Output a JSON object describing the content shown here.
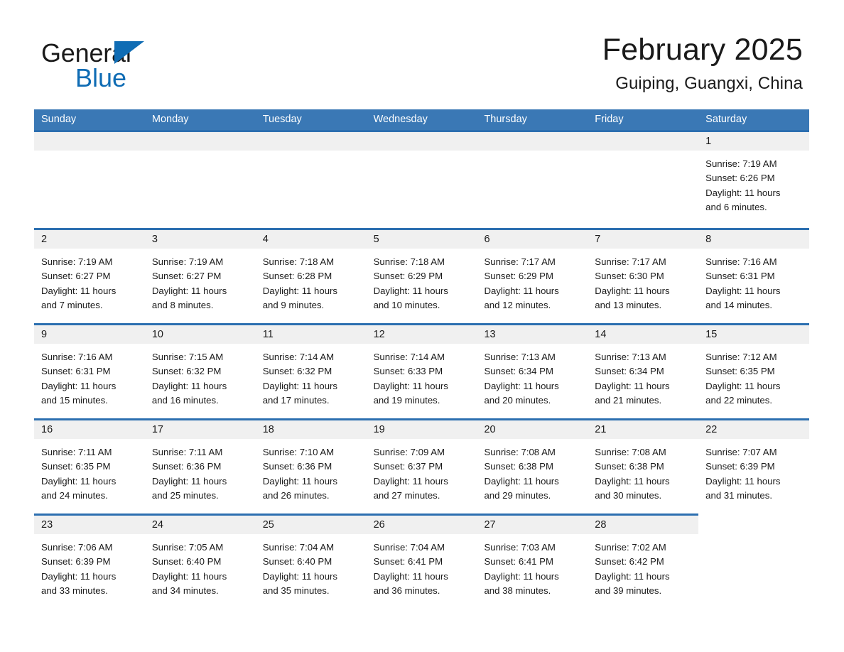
{
  "brand": {
    "name_part1": "General",
    "name_part2": "Blue",
    "accent_color": "#0f6cb4",
    "triangle_icon": "triangle-icon"
  },
  "header": {
    "month_title": "February 2025",
    "location": "Guiping, Guangxi, China"
  },
  "calendar": {
    "header_bg": "#3a78b5",
    "row_rule_color": "#2c6fb0",
    "daynum_band_bg": "#f0f0f0",
    "weekdays": [
      "Sunday",
      "Monday",
      "Tuesday",
      "Wednesday",
      "Thursday",
      "Friday",
      "Saturday"
    ],
    "weeks": [
      [
        {
          "day": "",
          "lines": []
        },
        {
          "day": "",
          "lines": []
        },
        {
          "day": "",
          "lines": []
        },
        {
          "day": "",
          "lines": []
        },
        {
          "day": "",
          "lines": []
        },
        {
          "day": "",
          "lines": []
        },
        {
          "day": "1",
          "lines": [
            "Sunrise: 7:19 AM",
            "Sunset: 6:26 PM",
            "Daylight: 11 hours",
            "and 6 minutes."
          ]
        }
      ],
      [
        {
          "day": "2",
          "lines": [
            "Sunrise: 7:19 AM",
            "Sunset: 6:27 PM",
            "Daylight: 11 hours",
            "and 7 minutes."
          ]
        },
        {
          "day": "3",
          "lines": [
            "Sunrise: 7:19 AM",
            "Sunset: 6:27 PM",
            "Daylight: 11 hours",
            "and 8 minutes."
          ]
        },
        {
          "day": "4",
          "lines": [
            "Sunrise: 7:18 AM",
            "Sunset: 6:28 PM",
            "Daylight: 11 hours",
            "and 9 minutes."
          ]
        },
        {
          "day": "5",
          "lines": [
            "Sunrise: 7:18 AM",
            "Sunset: 6:29 PM",
            "Daylight: 11 hours",
            "and 10 minutes."
          ]
        },
        {
          "day": "6",
          "lines": [
            "Sunrise: 7:17 AM",
            "Sunset: 6:29 PM",
            "Daylight: 11 hours",
            "and 12 minutes."
          ]
        },
        {
          "day": "7",
          "lines": [
            "Sunrise: 7:17 AM",
            "Sunset: 6:30 PM",
            "Daylight: 11 hours",
            "and 13 minutes."
          ]
        },
        {
          "day": "8",
          "lines": [
            "Sunrise: 7:16 AM",
            "Sunset: 6:31 PM",
            "Daylight: 11 hours",
            "and 14 minutes."
          ]
        }
      ],
      [
        {
          "day": "9",
          "lines": [
            "Sunrise: 7:16 AM",
            "Sunset: 6:31 PM",
            "Daylight: 11 hours",
            "and 15 minutes."
          ]
        },
        {
          "day": "10",
          "lines": [
            "Sunrise: 7:15 AM",
            "Sunset: 6:32 PM",
            "Daylight: 11 hours",
            "and 16 minutes."
          ]
        },
        {
          "day": "11",
          "lines": [
            "Sunrise: 7:14 AM",
            "Sunset: 6:32 PM",
            "Daylight: 11 hours",
            "and 17 minutes."
          ]
        },
        {
          "day": "12",
          "lines": [
            "Sunrise: 7:14 AM",
            "Sunset: 6:33 PM",
            "Daylight: 11 hours",
            "and 19 minutes."
          ]
        },
        {
          "day": "13",
          "lines": [
            "Sunrise: 7:13 AM",
            "Sunset: 6:34 PM",
            "Daylight: 11 hours",
            "and 20 minutes."
          ]
        },
        {
          "day": "14",
          "lines": [
            "Sunrise: 7:13 AM",
            "Sunset: 6:34 PM",
            "Daylight: 11 hours",
            "and 21 minutes."
          ]
        },
        {
          "day": "15",
          "lines": [
            "Sunrise: 7:12 AM",
            "Sunset: 6:35 PM",
            "Daylight: 11 hours",
            "and 22 minutes."
          ]
        }
      ],
      [
        {
          "day": "16",
          "lines": [
            "Sunrise: 7:11 AM",
            "Sunset: 6:35 PM",
            "Daylight: 11 hours",
            "and 24 minutes."
          ]
        },
        {
          "day": "17",
          "lines": [
            "Sunrise: 7:11 AM",
            "Sunset: 6:36 PM",
            "Daylight: 11 hours",
            "and 25 minutes."
          ]
        },
        {
          "day": "18",
          "lines": [
            "Sunrise: 7:10 AM",
            "Sunset: 6:36 PM",
            "Daylight: 11 hours",
            "and 26 minutes."
          ]
        },
        {
          "day": "19",
          "lines": [
            "Sunrise: 7:09 AM",
            "Sunset: 6:37 PM",
            "Daylight: 11 hours",
            "and 27 minutes."
          ]
        },
        {
          "day": "20",
          "lines": [
            "Sunrise: 7:08 AM",
            "Sunset: 6:38 PM",
            "Daylight: 11 hours",
            "and 29 minutes."
          ]
        },
        {
          "day": "21",
          "lines": [
            "Sunrise: 7:08 AM",
            "Sunset: 6:38 PM",
            "Daylight: 11 hours",
            "and 30 minutes."
          ]
        },
        {
          "day": "22",
          "lines": [
            "Sunrise: 7:07 AM",
            "Sunset: 6:39 PM",
            "Daylight: 11 hours",
            "and 31 minutes."
          ]
        }
      ],
      [
        {
          "day": "23",
          "lines": [
            "Sunrise: 7:06 AM",
            "Sunset: 6:39 PM",
            "Daylight: 11 hours",
            "and 33 minutes."
          ]
        },
        {
          "day": "24",
          "lines": [
            "Sunrise: 7:05 AM",
            "Sunset: 6:40 PM",
            "Daylight: 11 hours",
            "and 34 minutes."
          ]
        },
        {
          "day": "25",
          "lines": [
            "Sunrise: 7:04 AM",
            "Sunset: 6:40 PM",
            "Daylight: 11 hours",
            "and 35 minutes."
          ]
        },
        {
          "day": "26",
          "lines": [
            "Sunrise: 7:04 AM",
            "Sunset: 6:41 PM",
            "Daylight: 11 hours",
            "and 36 minutes."
          ]
        },
        {
          "day": "27",
          "lines": [
            "Sunrise: 7:03 AM",
            "Sunset: 6:41 PM",
            "Daylight: 11 hours",
            "and 38 minutes."
          ]
        },
        {
          "day": "28",
          "lines": [
            "Sunrise: 7:02 AM",
            "Sunset: 6:42 PM",
            "Daylight: 11 hours",
            "and 39 minutes."
          ]
        },
        {
          "day": "",
          "lines": []
        }
      ]
    ]
  }
}
